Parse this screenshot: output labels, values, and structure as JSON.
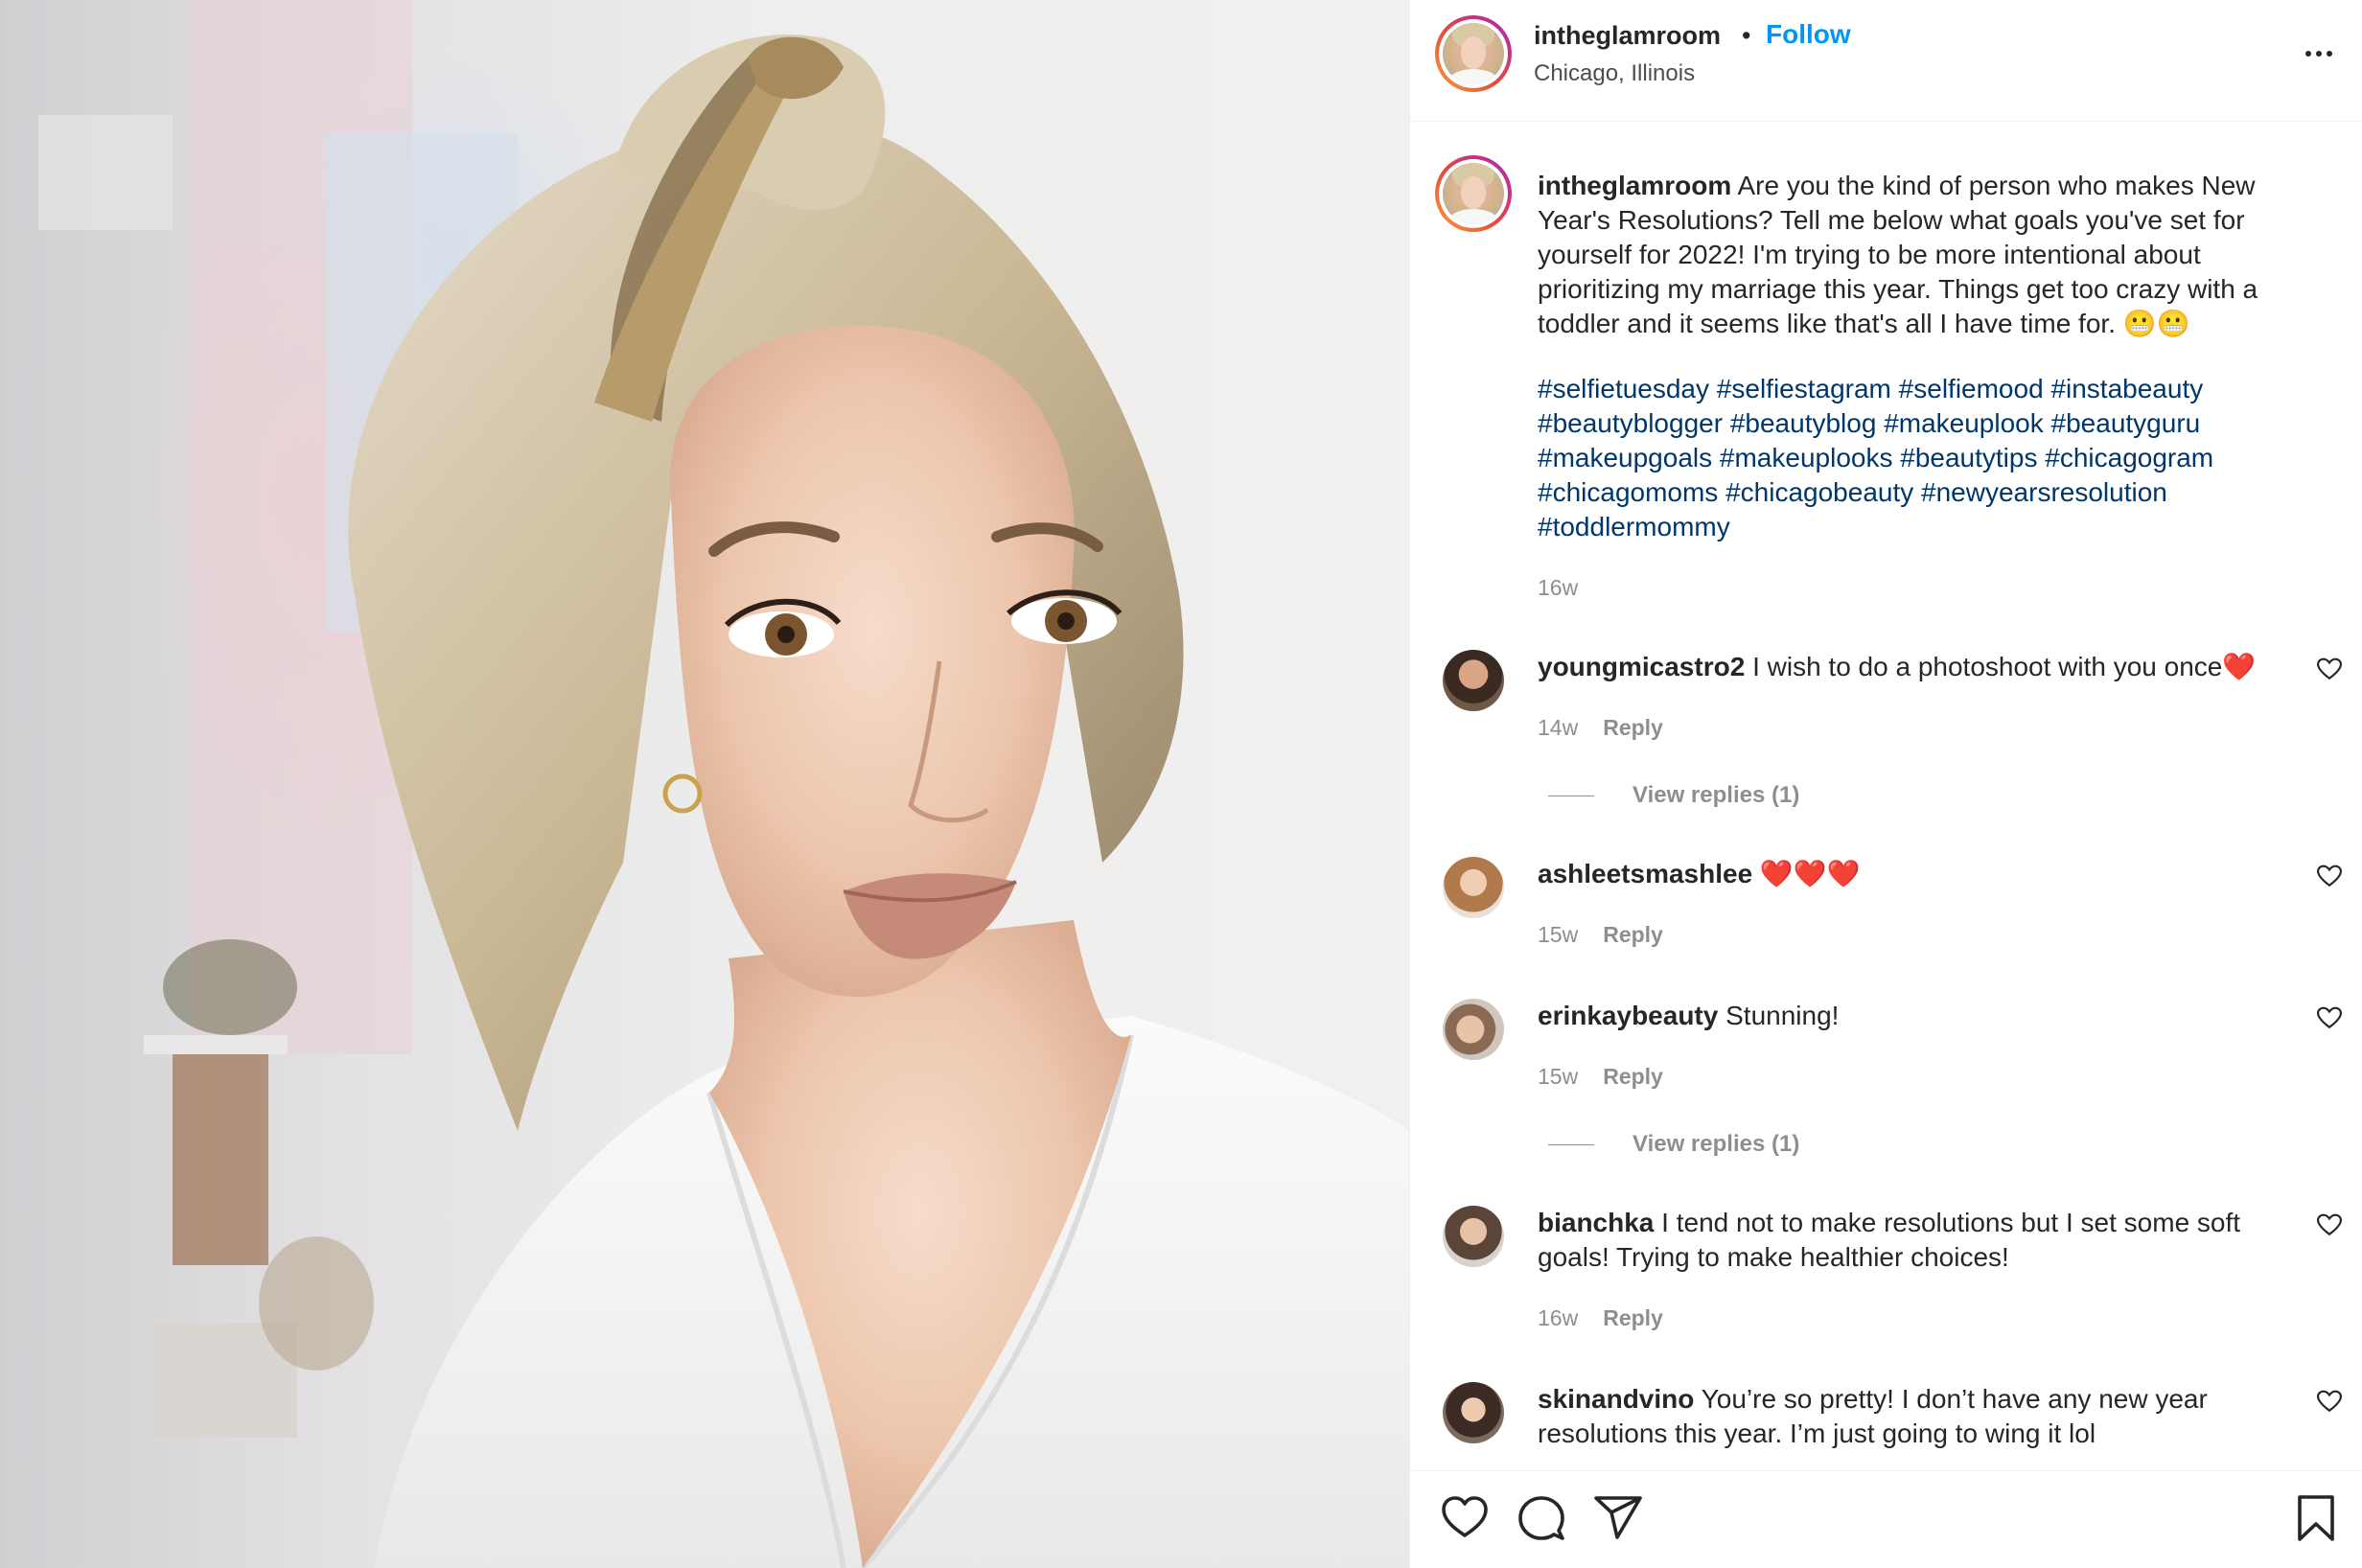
{
  "post": {
    "username": "intheglamroom",
    "follow_label": "Follow",
    "location": "Chicago, Illinois",
    "separator": "•"
  },
  "caption": {
    "username": "intheglamroom",
    "text": "Are you the kind of person who makes New Year's Resolutions? Tell me below what goals you've set for yourself for 2022! I'm trying to be more intentional about prioritizing my marriage this year. Things get too crazy with a toddler and it seems like that's all I have time for. 😬😬",
    "hashtags": [
      "#selfietuesday",
      "#selfiestagram",
      "#selfiemood",
      "#instabeauty",
      "#beautyblogger",
      "#beautyblog",
      "#makeuplook",
      "#beautyguru",
      "#makeupgoals",
      "#makeuplooks",
      "#beautytips",
      "#chicagogram",
      "#chicagomoms",
      "#chicagobeauty",
      "#newyearsresolution",
      "#toddlermommy"
    ],
    "time": "16w"
  },
  "comments": [
    {
      "username": "youngmicastro2",
      "text": "I wish to do a photoshoot with you once❤️",
      "time": "14w",
      "reply_label": "Reply",
      "view_replies": "View replies (1)"
    },
    {
      "username": "ashleetsmashlee",
      "text": "❤️❤️❤️",
      "time": "15w",
      "reply_label": "Reply"
    },
    {
      "username": "erinkaybeauty",
      "text": "Stunning!",
      "time": "15w",
      "reply_label": "Reply",
      "view_replies": "View replies (1)"
    },
    {
      "username": "bianchka",
      "text": "I tend not to make resolutions but I set some soft goals! Trying to make healthier choices!",
      "time": "16w",
      "reply_label": "Reply"
    },
    {
      "username": "skinandvino",
      "text": "You’re so pretty! I don’t have any new year resolutions this year. I’m just going to wing it lol"
    }
  ],
  "icons": {
    "like": "heart-icon",
    "comment": "comment-icon",
    "share": "share-icon",
    "save": "bookmark-icon",
    "more": "more-options-icon",
    "comment_like": "heart-icon"
  },
  "colors": {
    "follow_blue": "#0095f6",
    "hashtag": "#00376b",
    "muted": "#8e8e8e",
    "text": "#262626"
  }
}
